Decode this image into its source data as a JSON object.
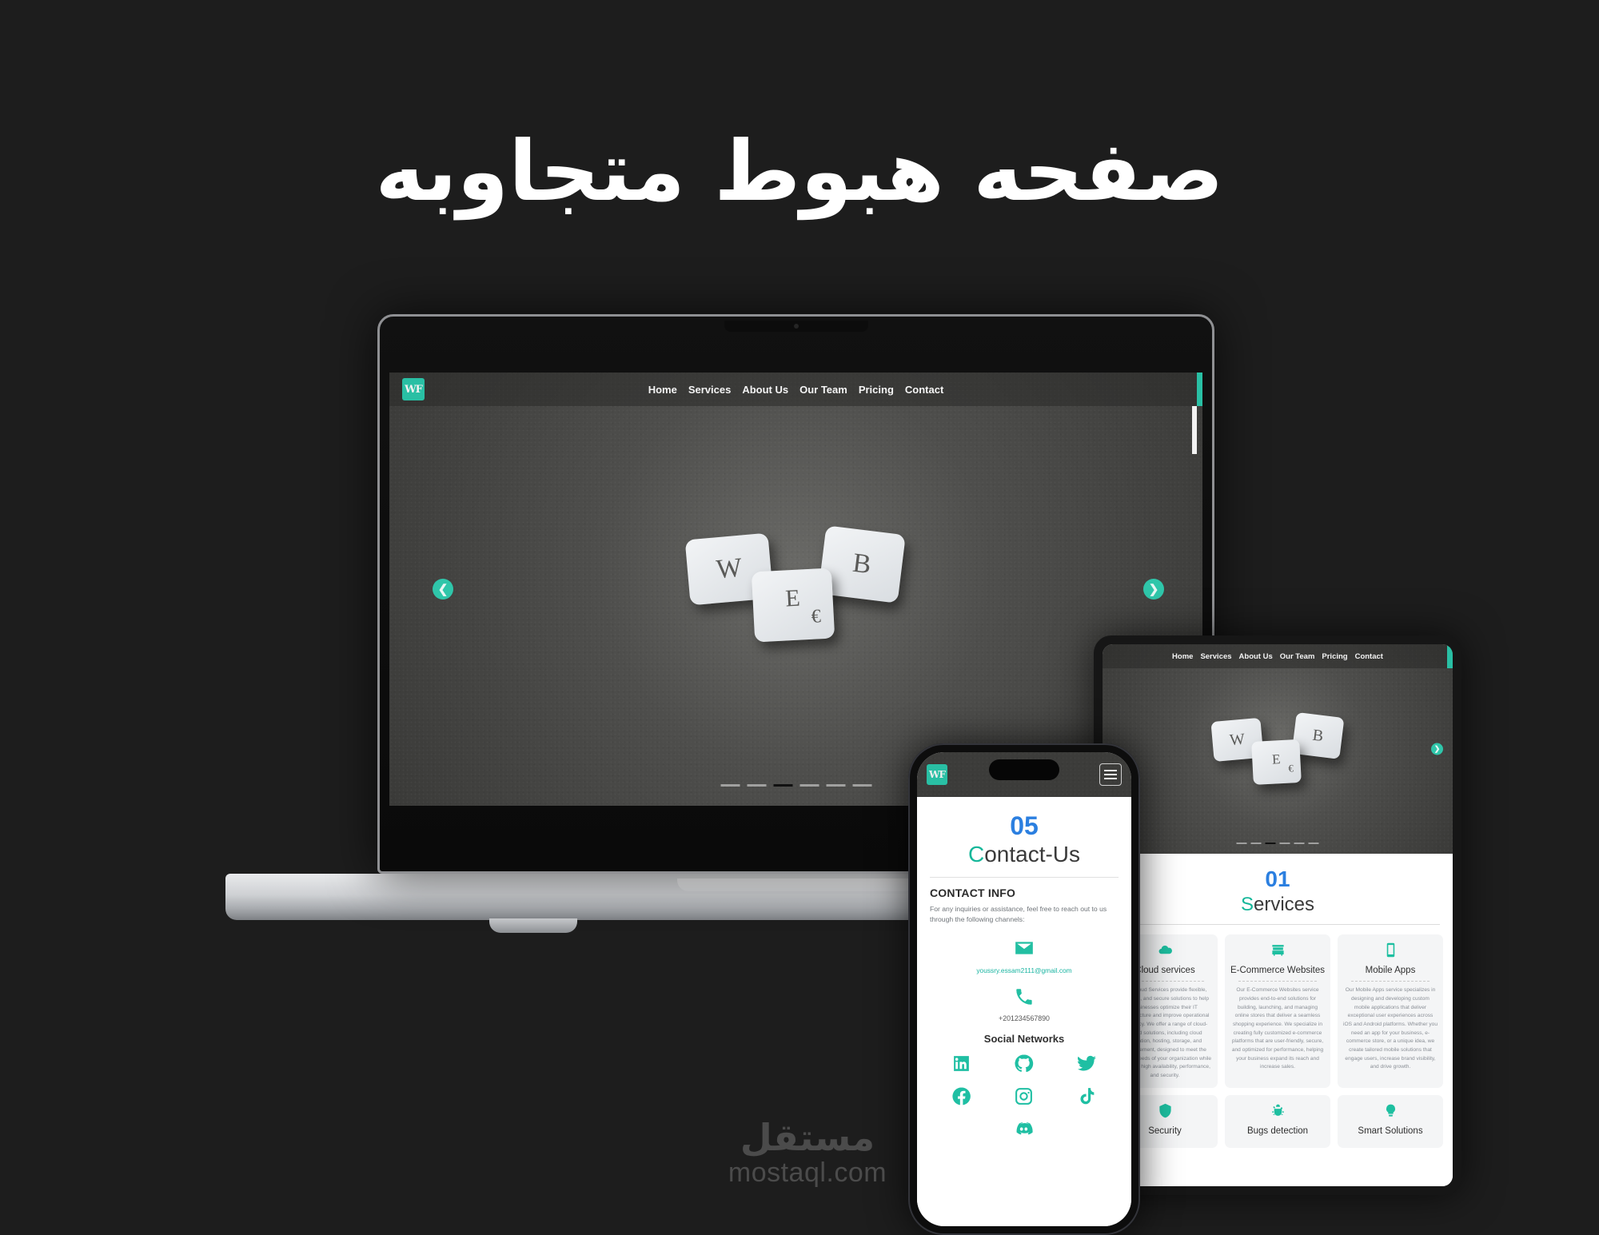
{
  "page": {
    "title_ar": "صفحه هبوط متجاوبه",
    "background_color": "#1d1d1d",
    "accent_color": "#29bfa4",
    "number_color": "#2b7fe0"
  },
  "watermark": {
    "arabic": "مستقل",
    "latin": "mostaql.com"
  },
  "site": {
    "logo_text": "WF",
    "nav": [
      {
        "label": "Home"
      },
      {
        "label": "Services"
      },
      {
        "label": "About Us"
      },
      {
        "label": "Our Team"
      },
      {
        "label": "Pricing"
      },
      {
        "label": "Contact"
      }
    ],
    "hero": {
      "keys": [
        {
          "glyph": "W"
        },
        {
          "glyph": "E",
          "secondary": "€"
        },
        {
          "glyph": "B"
        }
      ],
      "prev_arrow": "❮",
      "next_arrow": "❯",
      "slide_count": 6,
      "active_slide": 3
    }
  },
  "tablet": {
    "services_section": {
      "number": "01",
      "title_first": "S",
      "title_rest": "ervices",
      "cards": [
        {
          "icon": "cloud-icon",
          "name": "Cloud services",
          "desc": "Our Cloud Services provide flexible, scalable, and secure solutions to help businesses optimize their IT infrastructure and improve operational efficiency. We offer a range of cloud-based solutions, including cloud migration, hosting, storage, and management, designed to meet the unique needs of your organization while ensuring high availability, performance, and security."
        },
        {
          "icon": "store-icon",
          "name": "E-Commerce Websites",
          "desc": "Our E-Commerce Websites service provides end-to-end solutions for building, launching, and managing online stores that deliver a seamless shopping experience. We specialize in creating fully customized e-commerce platforms that are user-friendly, secure, and optimized for performance, helping your business expand its reach and increase sales."
        },
        {
          "icon": "mobile-icon",
          "name": "Mobile Apps",
          "desc": "Our Mobile Apps service specializes in designing and developing custom mobile applications that deliver exceptional user experiences across iOS and Android platforms. Whether you need an app for your business, e-commerce store, or a unique idea, we create tailored mobile solutions that engage users, increase brand visibility, and drive growth."
        },
        {
          "icon": "shield-icon",
          "name": "Security",
          "desc": ""
        },
        {
          "icon": "bug-icon",
          "name": "Bugs detection",
          "desc": ""
        },
        {
          "icon": "bulb-icon",
          "name": "Smart Solutions",
          "desc": ""
        }
      ]
    }
  },
  "phone": {
    "logo_text": "WF",
    "menu_icon": "hamburger-icon",
    "contact_section": {
      "number": "05",
      "title_first": "C",
      "title_rest": "ontact-Us",
      "heading": "CONTACT INFO",
      "paragraph": "For any inquiries or assistance, feel free to reach out to us through the following channels:",
      "email": "youssry.essam2111@gmail.com",
      "phone": "+201234567890",
      "social_heading": "Social Networks",
      "socials": [
        {
          "name": "linkedin-icon"
        },
        {
          "name": "github-icon"
        },
        {
          "name": "twitter-icon"
        },
        {
          "name": "facebook-icon"
        },
        {
          "name": "instagram-icon"
        },
        {
          "name": "tiktok-icon"
        },
        {
          "name": "discord-icon"
        }
      ]
    }
  }
}
